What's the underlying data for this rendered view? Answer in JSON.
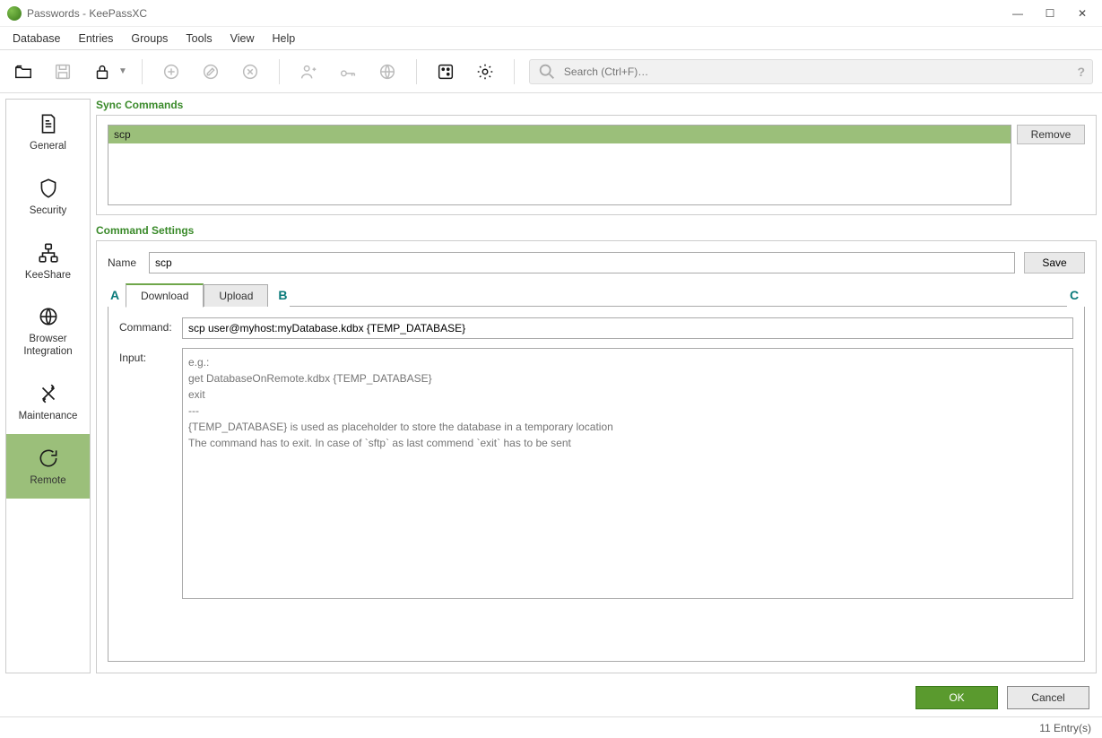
{
  "window": {
    "title": "Passwords - KeePassXC"
  },
  "menubar": {
    "items": [
      "Database",
      "Entries",
      "Groups",
      "Tools",
      "View",
      "Help"
    ]
  },
  "search": {
    "placeholder": "Search (Ctrl+F)…"
  },
  "sidebar": {
    "items": [
      {
        "label": "General"
      },
      {
        "label": "Security"
      },
      {
        "label": "KeeShare"
      },
      {
        "label": "Browser\nIntegration"
      },
      {
        "label": "Maintenance"
      },
      {
        "label": "Remote"
      }
    ],
    "selected": 5
  },
  "sync_commands": {
    "title": "Sync Commands",
    "items": [
      "scp"
    ],
    "remove_label": "Remove"
  },
  "command_settings": {
    "title": "Command Settings",
    "name_label": "Name",
    "name_value": "scp",
    "save_label": "Save",
    "tabs": {
      "download": "Download",
      "upload": "Upload",
      "active": "download"
    },
    "command_label": "Command:",
    "command_value": "scp user@myhost:myDatabase.kdbx {TEMP_DATABASE}",
    "input_label": "Input:",
    "input_placeholder": "e.g.:\nget DatabaseOnRemote.kdbx {TEMP_DATABASE}\nexit\n---\n{TEMP_DATABASE} is used as placeholder to store the database in a temporary location\nThe command has to exit. In case of `sftp` as last commend `exit` has to be sent"
  },
  "callouts": {
    "A": "A",
    "B": "B",
    "C": "C"
  },
  "dialog": {
    "ok": "OK",
    "cancel": "Cancel"
  },
  "statusbar": {
    "entries": "11 Entry(s)"
  }
}
